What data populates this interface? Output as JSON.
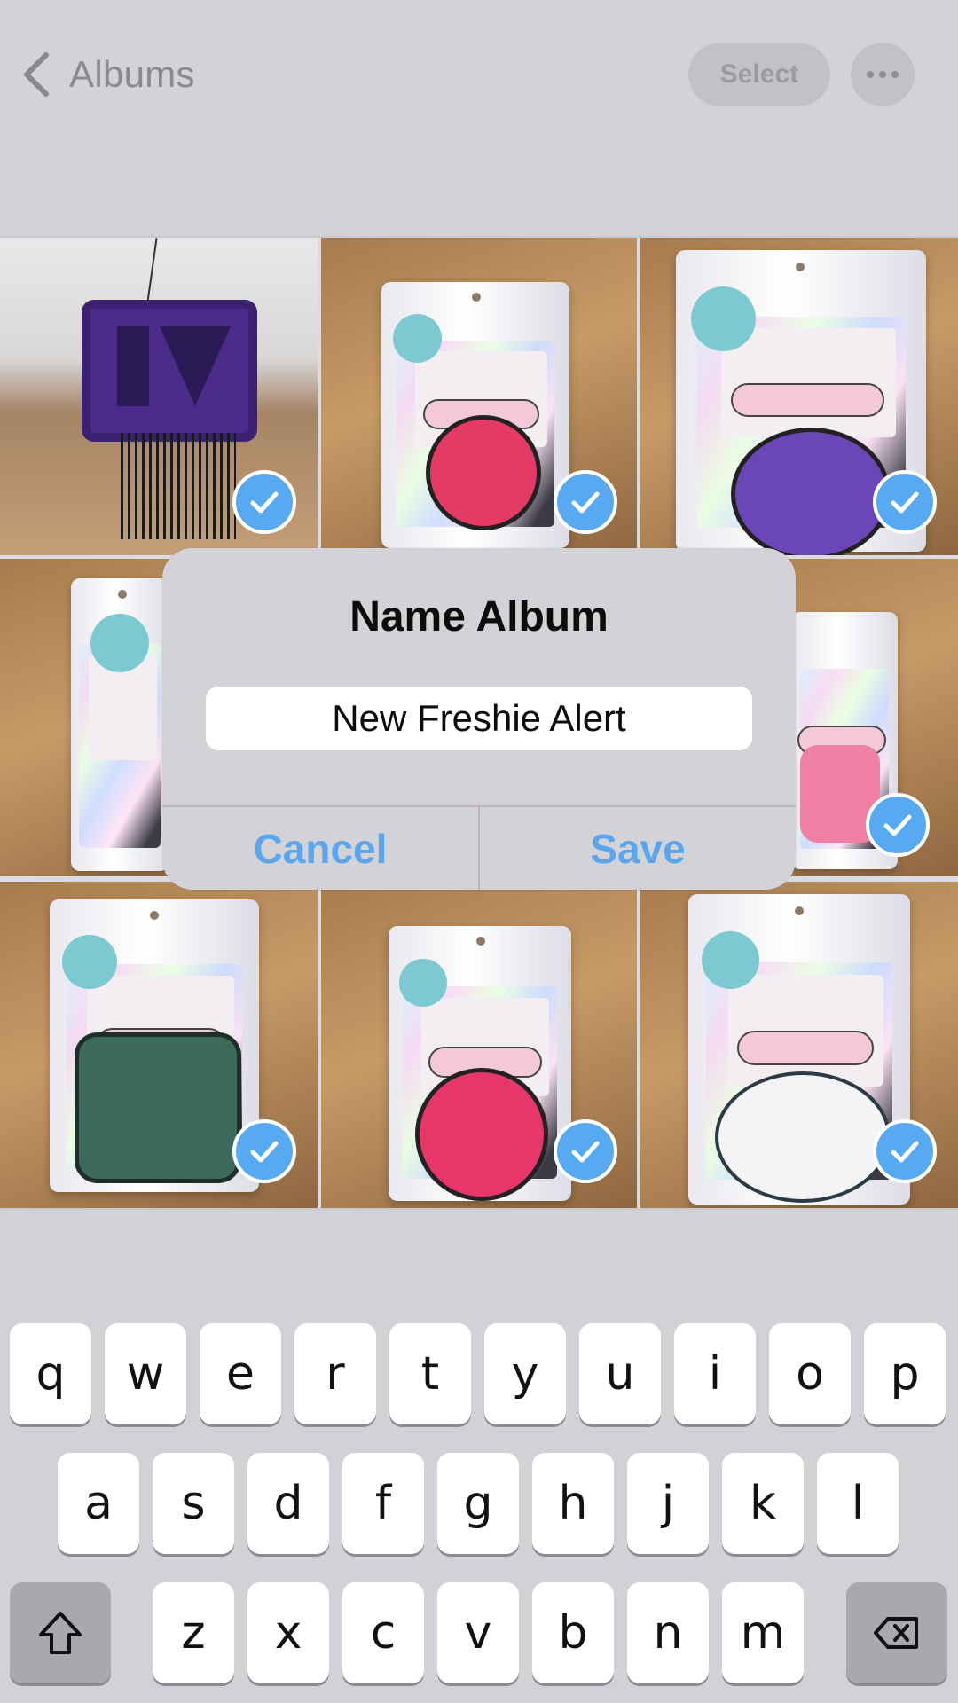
{
  "header": {
    "back_label": "Albums",
    "select_label": "Select",
    "more_icon": "ellipsis-icon"
  },
  "grid": {
    "items": [
      {
        "subject": "purple LV freshie with black fringe",
        "selected": true
      },
      {
        "subject": "pink softball heart freshie in bag",
        "selected": true
      },
      {
        "subject": "purple circle freshie in bag",
        "selected": true
      },
      {
        "subject": "freshie in bag with teal sticker",
        "selected": true
      },
      {
        "subject": "hidden behind dialog",
        "selected": true
      },
      {
        "subject": "pink letters freshie in bag",
        "selected": true
      },
      {
        "subject": "Loaded tea girly freshie in bag",
        "selected": true
      },
      {
        "subject": "pink round LV freshie in bag",
        "selected": true
      },
      {
        "subject": "white speckled freshie in bag",
        "selected": true
      }
    ]
  },
  "dialog": {
    "title": "Name Album",
    "input_value": "New Freshie Alert",
    "cancel_label": "Cancel",
    "save_label": "Save",
    "accent": "#5aa6ee"
  },
  "keyboard": {
    "row1": [
      "q",
      "w",
      "e",
      "r",
      "t",
      "y",
      "u",
      "i",
      "o",
      "p"
    ],
    "row2": [
      "a",
      "s",
      "d",
      "f",
      "g",
      "h",
      "j",
      "k",
      "l"
    ],
    "row3": [
      "z",
      "x",
      "c",
      "v",
      "b",
      "n",
      "m"
    ],
    "shift_icon": "shift-icon",
    "delete_icon": "backspace-icon"
  },
  "colors": {
    "check": "#57a9f1",
    "background": "#c9c8cd"
  }
}
